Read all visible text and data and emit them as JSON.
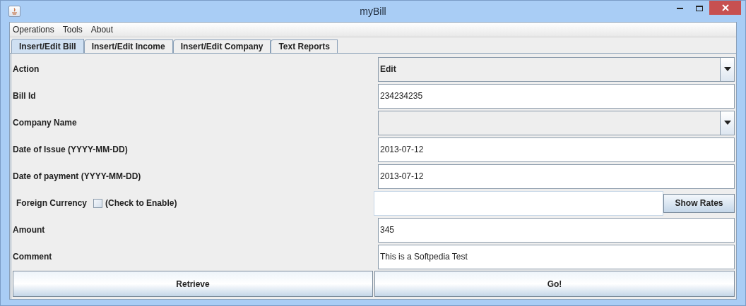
{
  "window": {
    "title": "myBill"
  },
  "menu": [
    "Operations",
    "Tools",
    "About"
  ],
  "tabs": [
    {
      "label": "Insert/Edit Bill",
      "selected": true
    },
    {
      "label": "Insert/Edit Income",
      "selected": false
    },
    {
      "label": "Insert/Edit Company",
      "selected": false
    },
    {
      "label": "Text Reports",
      "selected": false
    }
  ],
  "rows": [
    {
      "kind": "combo",
      "label": "Action",
      "value": "Edit"
    },
    {
      "kind": "text",
      "label": "Bill Id",
      "value": "234234235"
    },
    {
      "kind": "combo",
      "label": "Company Name"
    },
    {
      "kind": "text",
      "label": "Date of Issue (YYYY-MM-DD)",
      "value": "2013-07-12"
    },
    {
      "kind": "text",
      "label": "Date of payment (YYYY-MM-DD)",
      "value": "2013-07-12"
    },
    {
      "kind": "currency",
      "label": "Foreign Currency",
      "checkbox_label": "(Check to Enable)",
      "checked": false,
      "button": "Show Rates"
    },
    {
      "kind": "text",
      "label": "Amount",
      "value": "345"
    },
    {
      "kind": "text",
      "label": "Comment",
      "value": "This is a Softpedia Test"
    }
  ],
  "buttons": [
    "Retrieve",
    "Go!"
  ]
}
